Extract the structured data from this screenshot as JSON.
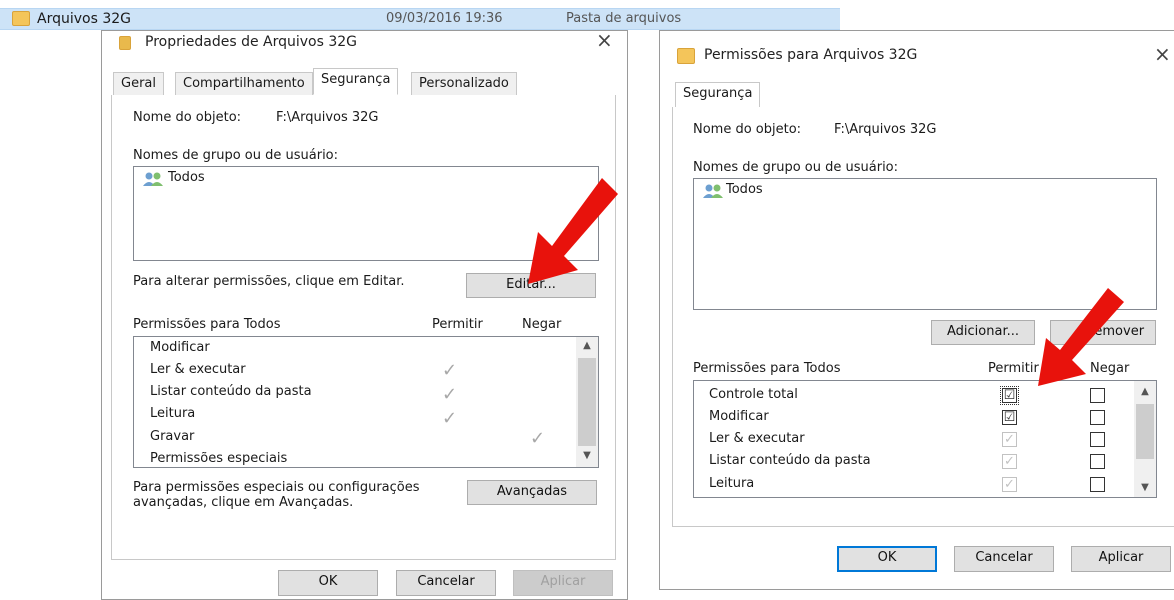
{
  "explorer": {
    "name": "Arquivos 32G",
    "date": "09/03/2016 19:36",
    "type": "Pasta de arquivos"
  },
  "props": {
    "title": "Propriedades de Arquivos 32G",
    "close": "×",
    "tabs": [
      "Geral",
      "Compartilhamento",
      "Segurança",
      "Personalizado"
    ],
    "object_label": "Nome do objeto:",
    "object_value": "F:\\Arquivos 32G",
    "groups_label": "Nomes de grupo ou de usuário:",
    "groups": [
      "Todos"
    ],
    "change_text": "Para alterar permissões, clique em Editar.",
    "edit_button": "Editar...",
    "perm_header": "Permissões para Todos",
    "col_allow": "Permitir",
    "col_deny": "Negar",
    "permissions": [
      {
        "name": "Modificar",
        "allow": "",
        "deny": ""
      },
      {
        "name": "Ler & executar",
        "allow": "✓",
        "deny": ""
      },
      {
        "name": "Listar conteúdo da pasta",
        "allow": "✓",
        "deny": ""
      },
      {
        "name": "Leitura",
        "allow": "✓",
        "deny": ""
      },
      {
        "name": "Gravar",
        "allow": "",
        "deny": "✓"
      },
      {
        "name": "Permissões especiais",
        "allow": "",
        "deny": ""
      }
    ],
    "advanced_text_1": "Para permissões especiais ou configurações",
    "advanced_text_2": "avançadas, clique em Avançadas.",
    "advanced_button": "Avançadas",
    "ok": "OK",
    "cancel": "Cancelar",
    "apply": "Aplicar"
  },
  "perm": {
    "title": "Permissões para Arquivos 32G",
    "close": "×",
    "tab": "Segurança",
    "object_label": "Nome do objeto:",
    "object_value": "F:\\Arquivos 32G",
    "groups_label": "Nomes de grupo ou de usuário:",
    "groups": [
      "Todos"
    ],
    "add_button": "Adicionar...",
    "remove_button": "Remover",
    "perm_header": "Permissões para Todos",
    "col_allow": "Permitir",
    "col_deny": "Negar",
    "permissions": [
      {
        "name": "Controle total",
        "allow": "☑",
        "deny": ""
      },
      {
        "name": "Modificar",
        "allow": "☑",
        "deny": ""
      },
      {
        "name": "Ler & executar",
        "allow": "✓",
        "deny": ""
      },
      {
        "name": "Listar conteúdo da pasta",
        "allow": "✓",
        "deny": ""
      },
      {
        "name": "Leitura",
        "allow": "✓",
        "deny": ""
      }
    ],
    "ok": "OK",
    "cancel": "Cancelar",
    "apply": "Aplicar"
  },
  "colors": {
    "arrow": "#e8120c",
    "focus": "#0078d7",
    "selection_row": "#cde3f7"
  }
}
